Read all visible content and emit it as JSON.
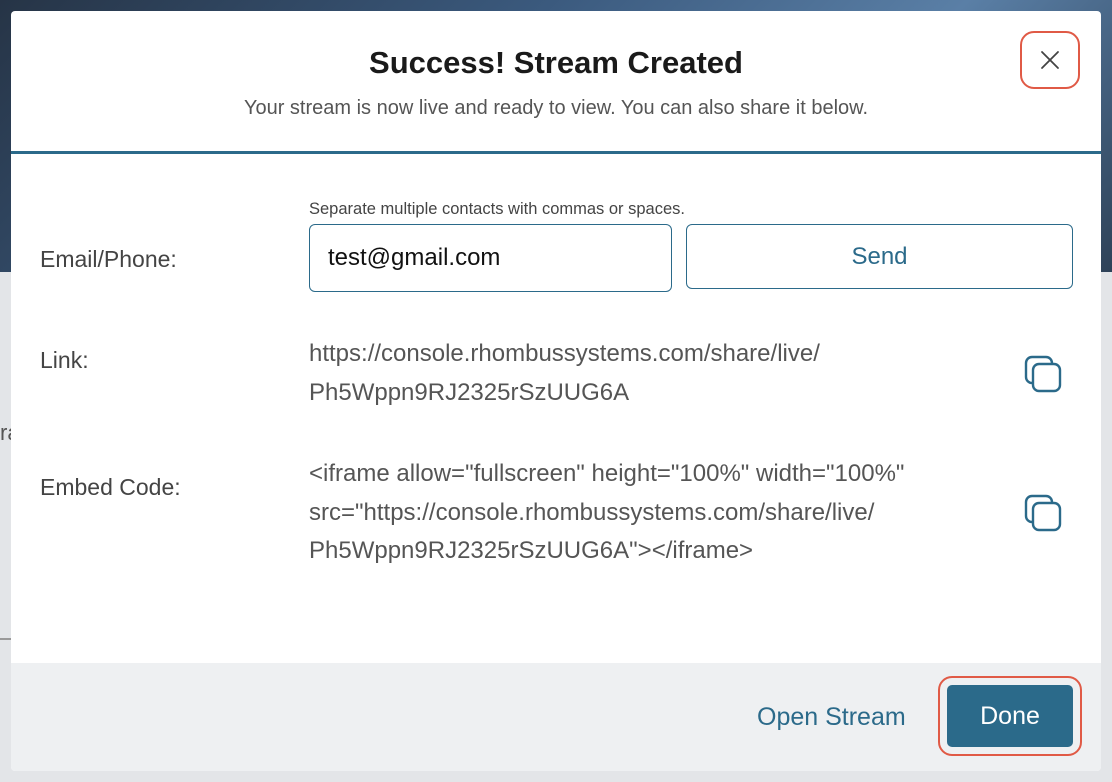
{
  "modal": {
    "title": "Success! Stream Created",
    "subtitle": "Your stream is now live and ready to view. You can also share it below."
  },
  "email": {
    "label": "Email/Phone:",
    "hint": "Separate multiple contacts with commas or spaces.",
    "value": "test@gmail.com",
    "send_label": "Send"
  },
  "link": {
    "label": "Link:",
    "line1": "https://console.rhombussystems.com/share/live/",
    "line2": "Ph5Wppn9RJ2325rSzUUG6A"
  },
  "embed": {
    "label": "Embed Code:",
    "line1": "<iframe allow=\"fullscreen\" height=\"100%\" width=\"100%\"",
    "line2": "src=\"https://console.rhombussystems.com/share/live/",
    "line3": "Ph5Wppn9RJ2325rSzUUG6A\"></iframe>"
  },
  "footer": {
    "open_stream_label": "Open Stream",
    "done_label": "Done"
  },
  "colors": {
    "accent": "#2b6a8a",
    "highlight_ring": "#e05a46"
  },
  "icons": {
    "close": "close-icon",
    "copy": "copy-icon"
  }
}
